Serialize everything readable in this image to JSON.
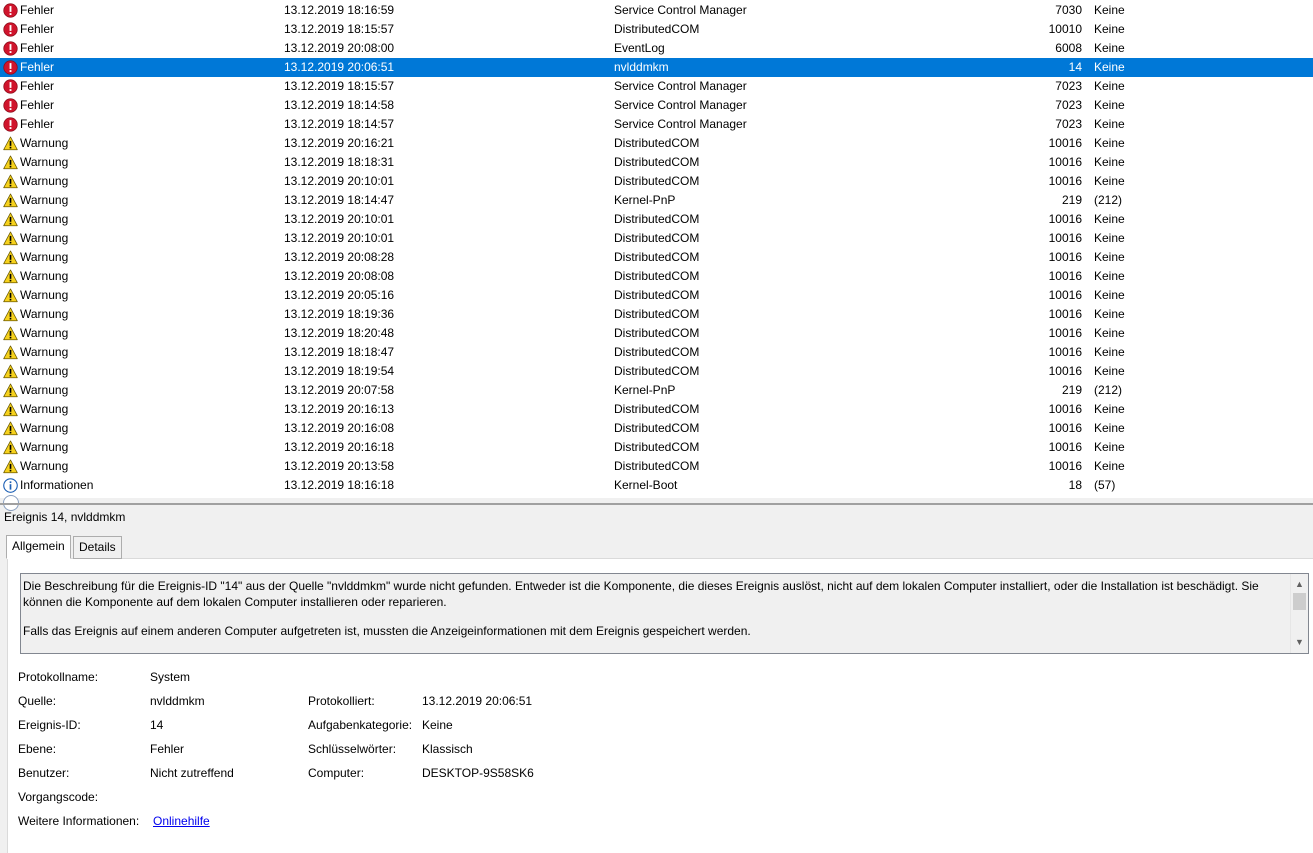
{
  "events": [
    {
      "level": "Fehler",
      "icon": "error",
      "datetime": "13.12.2019 18:16:59",
      "source": "Service Control Manager",
      "event_id": "7030",
      "category": "Keine"
    },
    {
      "level": "Fehler",
      "icon": "error",
      "datetime": "13.12.2019 18:15:57",
      "source": "DistributedCOM",
      "event_id": "10010",
      "category": "Keine"
    },
    {
      "level": "Fehler",
      "icon": "error",
      "datetime": "13.12.2019 20:08:00",
      "source": "EventLog",
      "event_id": "6008",
      "category": "Keine"
    },
    {
      "level": "Fehler",
      "icon": "error",
      "datetime": "13.12.2019 20:06:51",
      "source": "nvlddmkm",
      "event_id": "14",
      "category": "Keine",
      "selected": true
    },
    {
      "level": "Fehler",
      "icon": "error",
      "datetime": "13.12.2019 18:15:57",
      "source": "Service Control Manager",
      "event_id": "7023",
      "category": "Keine"
    },
    {
      "level": "Fehler",
      "icon": "error",
      "datetime": "13.12.2019 18:14:58",
      "source": "Service Control Manager",
      "event_id": "7023",
      "category": "Keine"
    },
    {
      "level": "Fehler",
      "icon": "error",
      "datetime": "13.12.2019 18:14:57",
      "source": "Service Control Manager",
      "event_id": "7023",
      "category": "Keine"
    },
    {
      "level": "Warnung",
      "icon": "warning",
      "datetime": "13.12.2019 20:16:21",
      "source": "DistributedCOM",
      "event_id": "10016",
      "category": "Keine"
    },
    {
      "level": "Warnung",
      "icon": "warning",
      "datetime": "13.12.2019 18:18:31",
      "source": "DistributedCOM",
      "event_id": "10016",
      "category": "Keine"
    },
    {
      "level": "Warnung",
      "icon": "warning",
      "datetime": "13.12.2019 20:10:01",
      "source": "DistributedCOM",
      "event_id": "10016",
      "category": "Keine"
    },
    {
      "level": "Warnung",
      "icon": "warning",
      "datetime": "13.12.2019 18:14:47",
      "source": "Kernel-PnP",
      "event_id": "219",
      "category": "(212)"
    },
    {
      "level": "Warnung",
      "icon": "warning",
      "datetime": "13.12.2019 20:10:01",
      "source": "DistributedCOM",
      "event_id": "10016",
      "category": "Keine"
    },
    {
      "level": "Warnung",
      "icon": "warning",
      "datetime": "13.12.2019 20:10:01",
      "source": "DistributedCOM",
      "event_id": "10016",
      "category": "Keine"
    },
    {
      "level": "Warnung",
      "icon": "warning",
      "datetime": "13.12.2019 20:08:28",
      "source": "DistributedCOM",
      "event_id": "10016",
      "category": "Keine"
    },
    {
      "level": "Warnung",
      "icon": "warning",
      "datetime": "13.12.2019 20:08:08",
      "source": "DistributedCOM",
      "event_id": "10016",
      "category": "Keine"
    },
    {
      "level": "Warnung",
      "icon": "warning",
      "datetime": "13.12.2019 20:05:16",
      "source": "DistributedCOM",
      "event_id": "10016",
      "category": "Keine"
    },
    {
      "level": "Warnung",
      "icon": "warning",
      "datetime": "13.12.2019 18:19:36",
      "source": "DistributedCOM",
      "event_id": "10016",
      "category": "Keine"
    },
    {
      "level": "Warnung",
      "icon": "warning",
      "datetime": "13.12.2019 18:20:48",
      "source": "DistributedCOM",
      "event_id": "10016",
      "category": "Keine"
    },
    {
      "level": "Warnung",
      "icon": "warning",
      "datetime": "13.12.2019 18:18:47",
      "source": "DistributedCOM",
      "event_id": "10016",
      "category": "Keine"
    },
    {
      "level": "Warnung",
      "icon": "warning",
      "datetime": "13.12.2019 18:19:54",
      "source": "DistributedCOM",
      "event_id": "10016",
      "category": "Keine"
    },
    {
      "level": "Warnung",
      "icon": "warning",
      "datetime": "13.12.2019 20:07:58",
      "source": "Kernel-PnP",
      "event_id": "219",
      "category": "(212)"
    },
    {
      "level": "Warnung",
      "icon": "warning",
      "datetime": "13.12.2019 20:16:13",
      "source": "DistributedCOM",
      "event_id": "10016",
      "category": "Keine"
    },
    {
      "level": "Warnung",
      "icon": "warning",
      "datetime": "13.12.2019 20:16:08",
      "source": "DistributedCOM",
      "event_id": "10016",
      "category": "Keine"
    },
    {
      "level": "Warnung",
      "icon": "warning",
      "datetime": "13.12.2019 20:16:18",
      "source": "DistributedCOM",
      "event_id": "10016",
      "category": "Keine"
    },
    {
      "level": "Warnung",
      "icon": "warning",
      "datetime": "13.12.2019 20:13:58",
      "source": "DistributedCOM",
      "event_id": "10016",
      "category": "Keine"
    },
    {
      "level": "Informationen",
      "icon": "info",
      "datetime": "13.12.2019 18:16:18",
      "source": "Kernel-Boot",
      "event_id": "18",
      "category": "(57)"
    }
  ],
  "colors": {
    "selection": "#0078d7",
    "error": "#d0142c",
    "warning": "#f7d21c",
    "info": "#1c5fb5",
    "link": "#0000ee"
  },
  "detail": {
    "header": "Ereignis 14, nvlddmkm",
    "tabs": {
      "general": "Allgemein",
      "details": "Details"
    },
    "description_p1": "Die Beschreibung für die Ereignis-ID \"14\" aus der Quelle \"nvlddmkm\" wurde nicht gefunden. Entweder ist die Komponente, die dieses Ereignis auslöst, nicht auf dem lokalen Computer installiert, oder die Installation ist beschädigt. Sie können die Komponente auf dem lokalen Computer installieren oder reparieren.",
    "description_p2": "Falls das Ereignis auf einem anderen Computer aufgetreten ist, mussten die Anzeigeinformationen mit dem Ereignis gespeichert werden.",
    "fields": {
      "logname_label": "Protokollname:",
      "logname": "System",
      "source_label": "Quelle:",
      "source": "nvlddmkm",
      "logged_label": "Protokolliert:",
      "logged": "13.12.2019 20:06:51",
      "eventid_label": "Ereignis-ID:",
      "eventid": "14",
      "taskcat_label": "Aufgabenkategorie:",
      "taskcat": "Keine",
      "level_label": "Ebene:",
      "level": "Fehler",
      "keywords_label": "Schlüsselwörter:",
      "keywords": "Klassisch",
      "user_label": "Benutzer:",
      "user": "Nicht zutreffend",
      "computer_label": "Computer:",
      "computer": "DESKTOP-9S58SK6",
      "opcode_label": "Vorgangscode:",
      "moreinfo_label": "Weitere Informationen:",
      "moreinfo_link": "Onlinehilfe"
    }
  }
}
